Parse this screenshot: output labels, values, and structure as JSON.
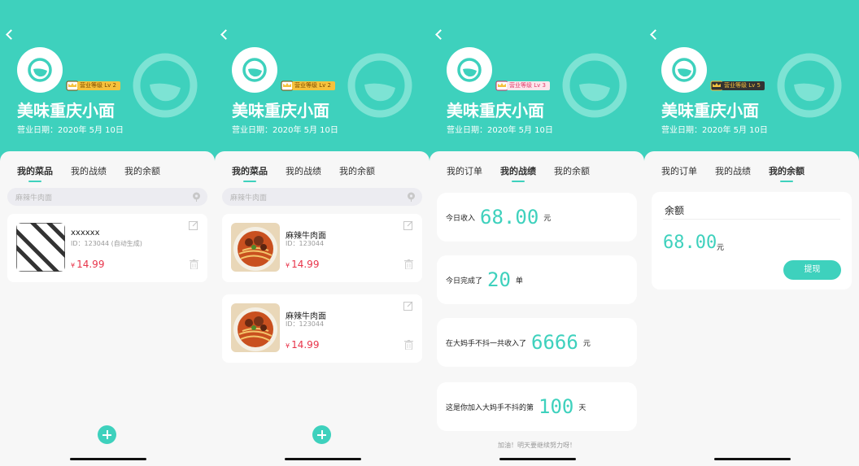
{
  "colors": {
    "accent": "#3ed1bd",
    "price": "#e8344a",
    "background": "#f6f6f6"
  },
  "store": {
    "name": "美味重庆小面",
    "open_date": "营业日期：2020年 5月 10日"
  },
  "screens": [
    {
      "level_badge": "营业等级 Lv 2",
      "tabs": [
        "我的菜品",
        "我的战绩",
        "我的余额"
      ],
      "active_tab": 0,
      "search_placeholder": "麻辣牛肉面",
      "dishes": [
        {
          "name": "xxxxxx",
          "id": "ID：123044    (自动生成)",
          "currency": "¥",
          "price": "14.99",
          "image": "placeholder-stripes"
        }
      ],
      "add_icon": "plus-icon"
    },
    {
      "level_badge": "营业等级 Lv 2",
      "tabs": [
        "我的菜品",
        "我的战绩",
        "我的余额"
      ],
      "active_tab": 0,
      "search_placeholder": "麻辣牛肉面",
      "dishes": [
        {
          "name": "麻辣牛肉面",
          "id": "ID：123044",
          "currency": "¥",
          "price": "14.99",
          "image": "beef-noodle"
        },
        {
          "name": "麻辣牛肉面",
          "id": "ID：123044",
          "currency": "¥",
          "price": "14.99",
          "image": "beef-noodle"
        }
      ],
      "add_icon": "plus-icon"
    },
    {
      "level_badge": "营业等级 Lv 3",
      "tabs": [
        "我的订单",
        "我的战绩",
        "我的余额"
      ],
      "active_tab": 1,
      "stats": [
        {
          "pre": "今日收入",
          "value": "68.00",
          "unit": "元"
        },
        {
          "pre": "今日完成了",
          "value": "20",
          "unit": "单"
        },
        {
          "pre": "在大妈手不抖一共收入了",
          "value": "6666",
          "unit": "元"
        },
        {
          "pre": "这是你加入大妈手不抖的第",
          "value": "100",
          "unit": "天"
        }
      ],
      "cheer": "加油！明天要继续努力呀！"
    },
    {
      "level_badge": "营业等级 Lv 5",
      "tabs": [
        "我的订单",
        "我的战绩",
        "我的余额"
      ],
      "active_tab": 2,
      "balance": {
        "title": "余额",
        "amount": "68.00",
        "unit": "元",
        "withdraw": "提现"
      }
    }
  ]
}
